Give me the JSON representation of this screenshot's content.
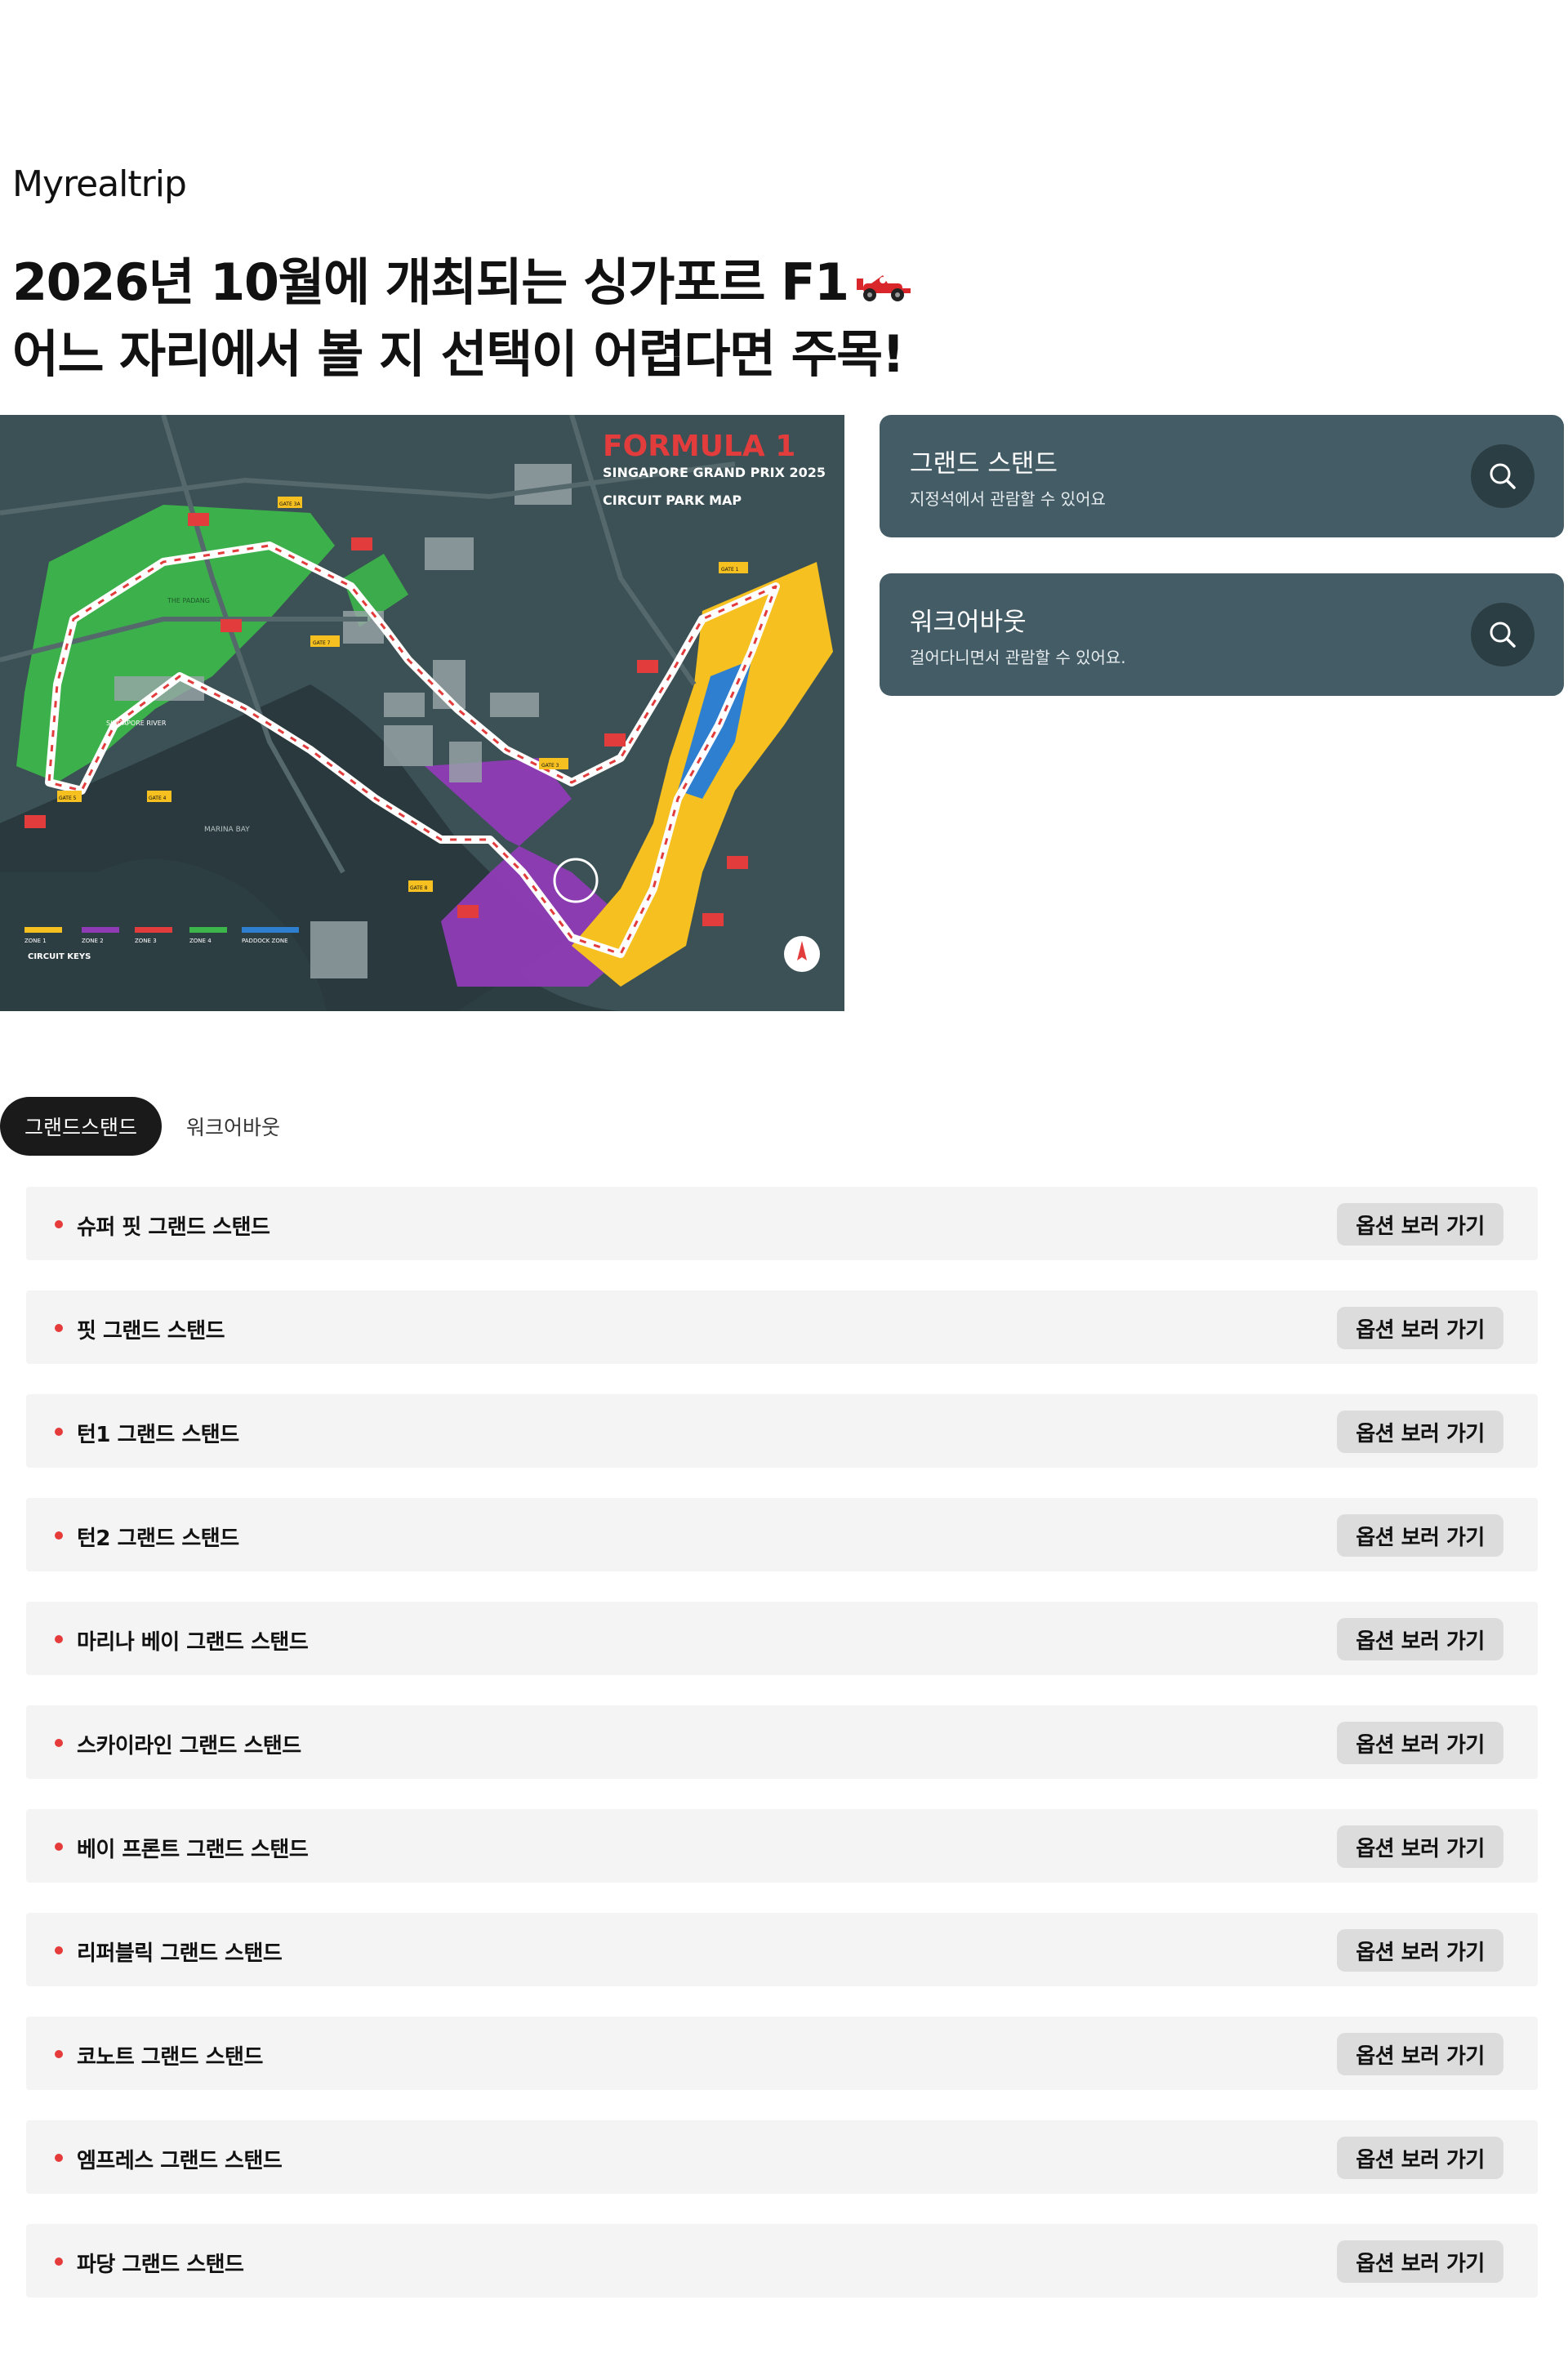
{
  "brand": {
    "logo": "Myrealtrip"
  },
  "headline": {
    "line1": "2026년 10월에 개최되는 싱가포르 F1",
    "line2": "어느 자리에서 볼 지 선택이 어렵다면 주목!"
  },
  "map": {
    "title": "FORMULA 1",
    "subtitle": "SINGAPORE GRAND PRIX 2025",
    "caption": "CIRCUIT PARK MAP",
    "water_label": "MARINA BAY",
    "river_label": "SINGAPORE RIVER",
    "park_label": "THE PADANG",
    "keys_label": "CIRCUIT KEYS",
    "zones": [
      "ZONE 1",
      "ZONE 2",
      "ZONE 3",
      "ZONE 4",
      "PADDOCK ZONE"
    ],
    "zone_colors": [
      "#f5c020",
      "#8e3bb5",
      "#e23c3c",
      "#3cb54a",
      "#2f7fd1"
    ],
    "gates": [
      "GATE 1",
      "GATE 3",
      "GATE 4",
      "GATE 5",
      "GATE 7",
      "GATE 8",
      "GATE 3A"
    ]
  },
  "zone_cards": [
    {
      "title": "그랜드 스탠드",
      "desc": "지정석에서 관람할 수 있어요",
      "icon": "search-icon"
    },
    {
      "title": "워크어바웃",
      "desc": "걸어다니면서 관람할 수 있어요.",
      "icon": "search-icon"
    }
  ],
  "tabs": {
    "active": "그랜드스탠드",
    "inactive": "워크어바웃"
  },
  "button_label": "옵션 보러 가기",
  "stands": [
    "슈퍼 핏 그랜드 스탠드",
    "핏 그랜드 스탠드",
    "턴1 그랜드 스탠드",
    "턴2 그랜드 스탠드",
    "마리나 베이 그랜드 스탠드",
    "스카이라인 그랜드 스탠드",
    "베이 프론트 그랜드 스탠드",
    "리퍼블릭 그랜드 스탠드",
    "코노트 그랜드 스탠드",
    "엠프레스 그랜드 스탠드",
    "파당 그랜드 스탠드"
  ]
}
